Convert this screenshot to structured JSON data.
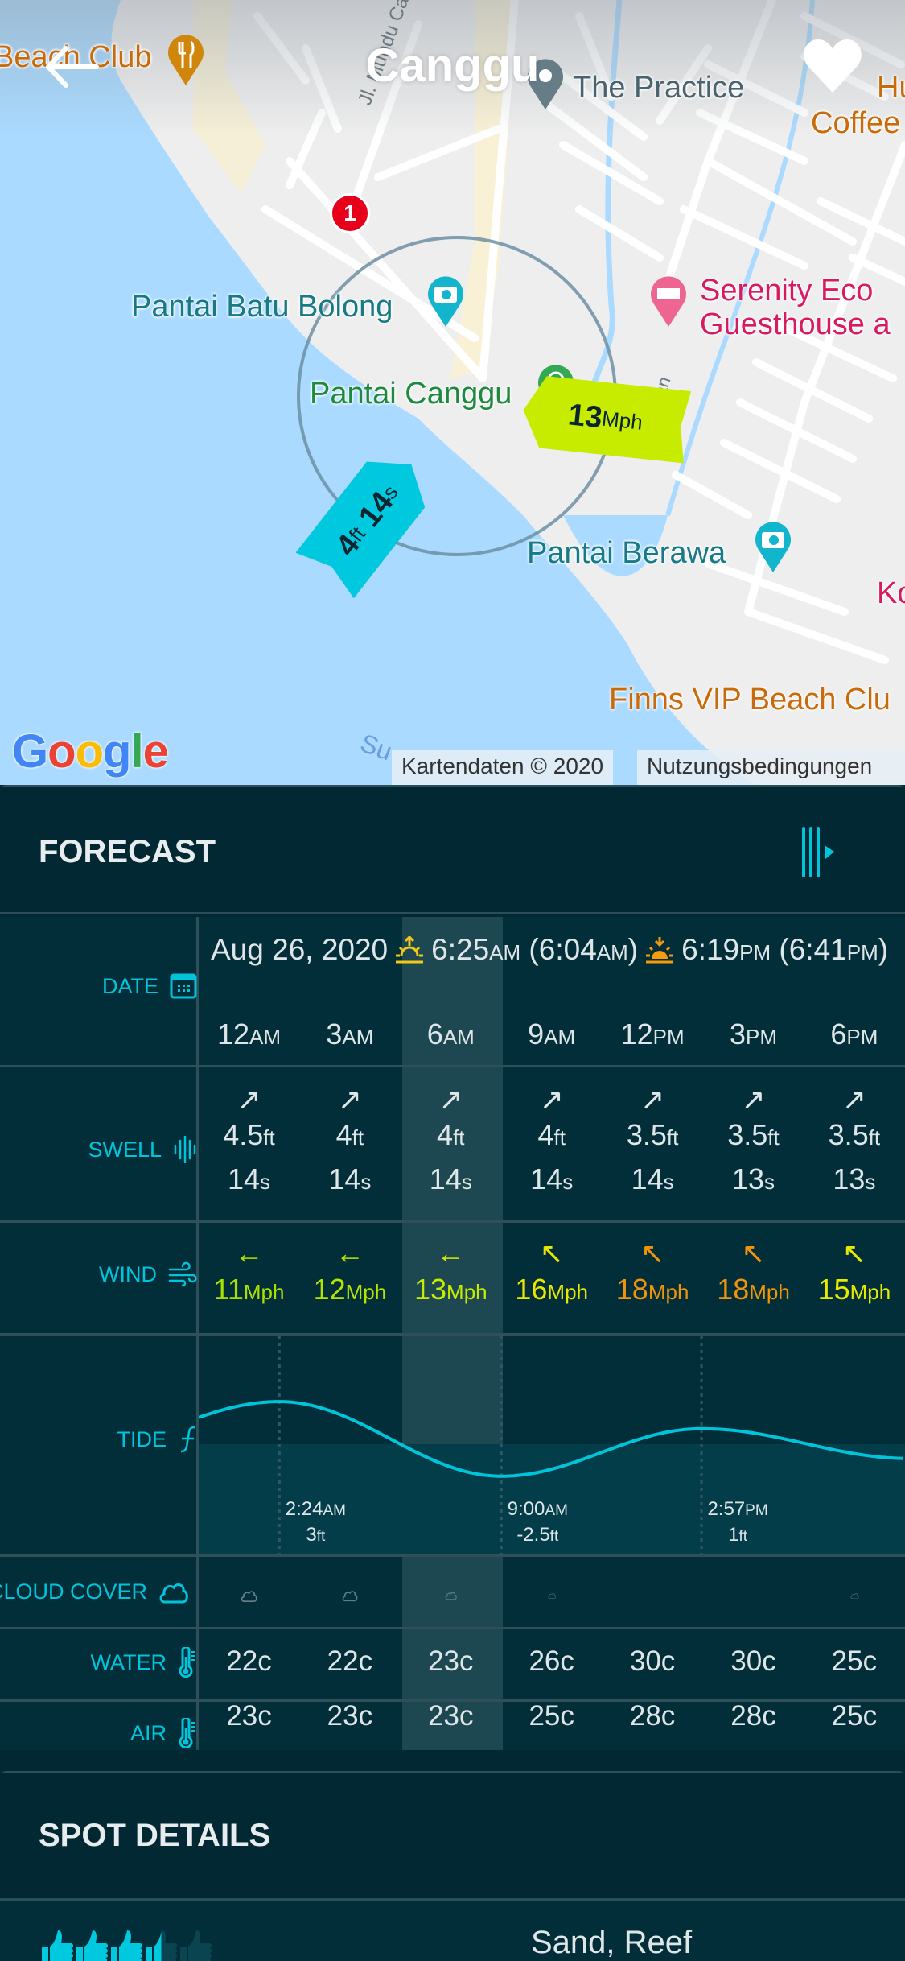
{
  "header": {
    "title": "Canggu",
    "back_icon": "arrow-left-icon",
    "favorite_icon": "heart-icon"
  },
  "map": {
    "labels": {
      "beach_club": "Beach Club",
      "the_practice": "The Practice",
      "hungry_coffee_1": "Hur",
      "hungry_coffee_2": "Coffee",
      "street_1": "Jl. Mundu Catu",
      "street_2": "ayan",
      "batu_bolong": "Pantai Batu Bolong",
      "serenity_1": "Serenity Eco",
      "serenity_2": "Guesthouse a",
      "canggu_beach": "Pantai Canggu",
      "berawa": "Pantai Berawa",
      "k_label": "Ko",
      "finns": "Finns VIP Beach Clu",
      "su_label": "Su"
    },
    "marker_number": "1",
    "swell_badge": {
      "height": "4",
      "height_unit": "ft",
      "period": "14",
      "period_unit": "s"
    },
    "wind_badge": {
      "speed": "13",
      "unit": "Mph"
    },
    "google_logo": "Google",
    "attribution": "Kartendaten © 2020",
    "terms": "Nutzungsbedingungen",
    "colors": {
      "water": "#aadaff",
      "land": "#eeeeee",
      "swell_badge": "#00c8de",
      "wind_badge": "#c8ec00"
    }
  },
  "forecast": {
    "title": "FORECAST",
    "play_icon": "timeline-play-icon",
    "date": "Aug 26, 2020",
    "sunrise": {
      "time": "6:25",
      "ampm": "AM",
      "first_light": "6:04",
      "first_light_ampm": "AM"
    },
    "sunset": {
      "time": "6:19",
      "ampm": "PM",
      "last_light": "6:41",
      "last_light_ampm": "PM"
    },
    "row_labels": {
      "date": "DATE",
      "swell": "SWELL",
      "wind": "WIND",
      "tide": "TIDE",
      "cloud": "CLOUD COVER",
      "water": "WATER",
      "air": "AIR"
    },
    "selected_column": 2,
    "hours": [
      {
        "h": "12",
        "ap": "AM"
      },
      {
        "h": "3",
        "ap": "AM"
      },
      {
        "h": "6",
        "ap": "AM"
      },
      {
        "h": "9",
        "ap": "AM"
      },
      {
        "h": "12",
        "ap": "PM"
      },
      {
        "h": "3",
        "ap": "PM"
      },
      {
        "h": "6",
        "ap": "PM"
      }
    ],
    "swell": [
      {
        "dir": "↗",
        "height": "4.5",
        "h_unit": "ft",
        "period": "14",
        "p_unit": "s"
      },
      {
        "dir": "↗",
        "height": "4",
        "h_unit": "ft",
        "period": "14",
        "p_unit": "s"
      },
      {
        "dir": "↗",
        "height": "4",
        "h_unit": "ft",
        "period": "14",
        "p_unit": "s"
      },
      {
        "dir": "↗",
        "height": "4",
        "h_unit": "ft",
        "period": "14",
        "p_unit": "s"
      },
      {
        "dir": "↗",
        "height": "3.5",
        "h_unit": "ft",
        "period": "14",
        "p_unit": "s"
      },
      {
        "dir": "↗",
        "height": "3.5",
        "h_unit": "ft",
        "period": "13",
        "p_unit": "s"
      },
      {
        "dir": "↗",
        "height": "3.5",
        "h_unit": "ft",
        "period": "13",
        "p_unit": "s"
      }
    ],
    "wind": [
      {
        "dir": "←",
        "speed": "11",
        "unit": "Mph",
        "color": "#a8e000"
      },
      {
        "dir": "←",
        "speed": "12",
        "unit": "Mph",
        "color": "#b4e400"
      },
      {
        "dir": "←",
        "speed": "13",
        "unit": "Mph",
        "color": "#c8ec00"
      },
      {
        "dir": "↖",
        "speed": "16",
        "unit": "Mph",
        "color": "#e8e800"
      },
      {
        "dir": "↖",
        "speed": "18",
        "unit": "Mph",
        "color": "#f0950a"
      },
      {
        "dir": "↖",
        "speed": "18",
        "unit": "Mph",
        "color": "#f0950a"
      },
      {
        "dir": "↖",
        "speed": "15",
        "unit": "Mph",
        "color": "#e4ea00"
      }
    ],
    "tide": {
      "extremes": [
        {
          "time": "2:24",
          "ampm": "AM",
          "height": "3",
          "unit": "ft",
          "hour": 2.4
        },
        {
          "time": "9:00",
          "ampm": "AM",
          "height": "-2.5",
          "unit": "ft",
          "hour": 9.0
        },
        {
          "time": "2:57",
          "ampm": "PM",
          "height": "1",
          "unit": "ft",
          "hour": 14.95
        }
      ],
      "line_color": "#00c4da"
    },
    "cloud_cover": [
      0.55,
      0.5,
      0.3,
      0.1,
      0,
      0,
      0.12
    ],
    "water_temp": [
      "22c",
      "22c",
      "23c",
      "26c",
      "30c",
      "30c",
      "25c"
    ],
    "air_temp": [
      "23c",
      "23c",
      "23c",
      "25c",
      "28c",
      "28c",
      "25c"
    ]
  },
  "spot_details": {
    "title": "SPOT DETAILS",
    "rating": 3.5,
    "rating_max": 5,
    "bottom_type": "Sand, Reef"
  }
}
